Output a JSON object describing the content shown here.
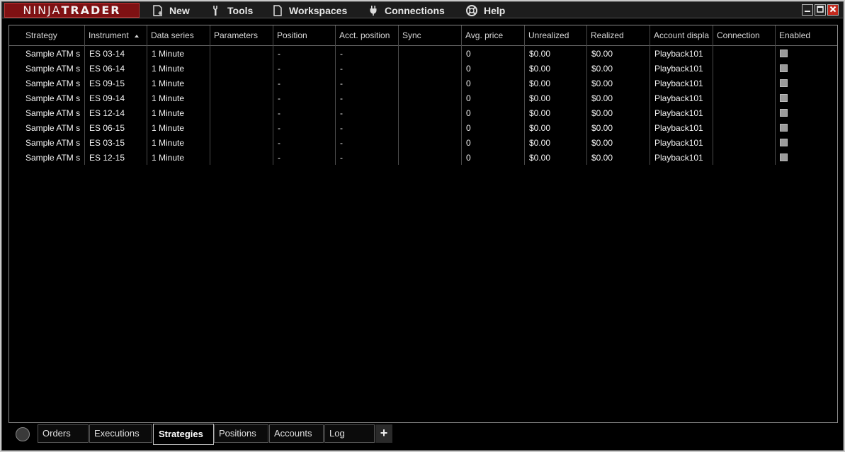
{
  "app": {
    "logo_left": "NINJA",
    "logo_right": "TRADER"
  },
  "menu": [
    {
      "label": "New",
      "icon": "new-document-icon"
    },
    {
      "label": "Tools",
      "icon": "wrench-icon"
    },
    {
      "label": "Workspaces",
      "icon": "document-icon"
    },
    {
      "label": "Connections",
      "icon": "plug-icon"
    },
    {
      "label": "Help",
      "icon": "lifebuoy-icon"
    }
  ],
  "window_controls": {
    "minimize": "minimize-icon",
    "maximize": "maximize-icon",
    "close": "close-icon",
    "close_color": "#c42a1e"
  },
  "grid": {
    "columns": [
      "Strategy",
      "Instrument",
      "Data series",
      "Parameters",
      "Position",
      "Acct. position",
      "Sync",
      "Avg. price",
      "Unrealized",
      "Realized",
      "Account displa",
      "Connection",
      "Enabled"
    ],
    "sorted_column": "Instrument",
    "rows": [
      {
        "strategy": "Sample ATM s",
        "instrument": "ES 03-14",
        "data_series": "1 Minute",
        "parameters": "",
        "position": "-",
        "acct_position": "-",
        "sync": "",
        "avg_price": "0",
        "unrealized": "$0.00",
        "realized": "$0.00",
        "account": "Playback101",
        "connection": "",
        "enabled": false
      },
      {
        "strategy": "Sample ATM s",
        "instrument": "ES 06-14",
        "data_series": "1 Minute",
        "parameters": "",
        "position": "-",
        "acct_position": "-",
        "sync": "",
        "avg_price": "0",
        "unrealized": "$0.00",
        "realized": "$0.00",
        "account": "Playback101",
        "connection": "",
        "enabled": false
      },
      {
        "strategy": "Sample ATM s",
        "instrument": "ES 09-15",
        "data_series": "1 Minute",
        "parameters": "",
        "position": "-",
        "acct_position": "-",
        "sync": "",
        "avg_price": "0",
        "unrealized": "$0.00",
        "realized": "$0.00",
        "account": "Playback101",
        "connection": "",
        "enabled": false
      },
      {
        "strategy": "Sample ATM s",
        "instrument": "ES 09-14",
        "data_series": "1 Minute",
        "parameters": "",
        "position": "-",
        "acct_position": "-",
        "sync": "",
        "avg_price": "0",
        "unrealized": "$0.00",
        "realized": "$0.00",
        "account": "Playback101",
        "connection": "",
        "enabled": false
      },
      {
        "strategy": "Sample ATM s",
        "instrument": "ES 12-14",
        "data_series": "1 Minute",
        "parameters": "",
        "position": "-",
        "acct_position": "-",
        "sync": "",
        "avg_price": "0",
        "unrealized": "$0.00",
        "realized": "$0.00",
        "account": "Playback101",
        "connection": "",
        "enabled": false
      },
      {
        "strategy": "Sample ATM s",
        "instrument": "ES 06-15",
        "data_series": "1 Minute",
        "parameters": "",
        "position": "-",
        "acct_position": "-",
        "sync": "",
        "avg_price": "0",
        "unrealized": "$0.00",
        "realized": "$0.00",
        "account": "Playback101",
        "connection": "",
        "enabled": false
      },
      {
        "strategy": "Sample ATM s",
        "instrument": "ES 03-15",
        "data_series": "1 Minute",
        "parameters": "",
        "position": "-",
        "acct_position": "-",
        "sync": "",
        "avg_price": "0",
        "unrealized": "$0.00",
        "realized": "$0.00",
        "account": "Playback101",
        "connection": "",
        "enabled": false
      },
      {
        "strategy": "Sample ATM s",
        "instrument": "ES 12-15",
        "data_series": "1 Minute",
        "parameters": "",
        "position": "-",
        "acct_position": "-",
        "sync": "",
        "avg_price": "0",
        "unrealized": "$0.00",
        "realized": "$0.00",
        "account": "Playback101",
        "connection": "",
        "enabled": false
      }
    ]
  },
  "tabs": [
    {
      "label": "Orders",
      "active": false
    },
    {
      "label": "Executions",
      "active": false
    },
    {
      "label": "Strategies",
      "active": true
    },
    {
      "label": "Positions",
      "active": false
    },
    {
      "label": "Accounts",
      "active": false
    },
    {
      "label": "Log",
      "active": false
    }
  ],
  "tab_add_label": "+",
  "colors": {
    "logo_bg": "#7f1113",
    "background": "#000000",
    "text": "#f2f2f2"
  }
}
